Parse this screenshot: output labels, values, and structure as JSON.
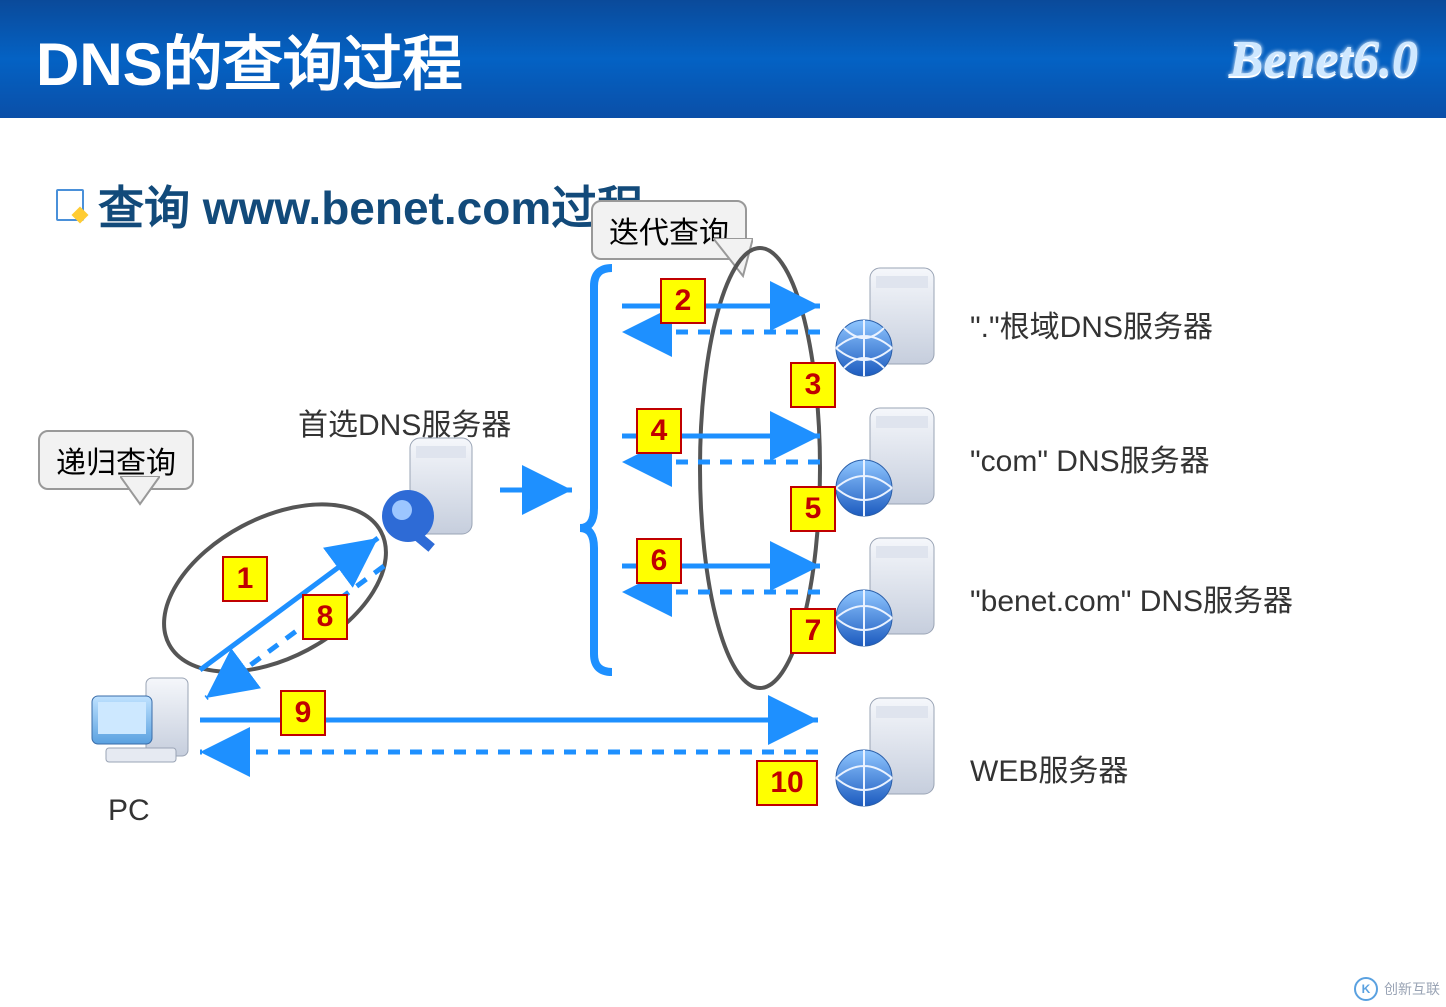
{
  "header": {
    "title": "DNS的查询过程",
    "brand": "Benet6.0"
  },
  "subtitle": "查询 www.benet.com过程",
  "callouts": {
    "recursive": "递归查询",
    "iterative": "迭代查询"
  },
  "nodes": {
    "pc": "PC",
    "local_dns": "首选DNS服务器",
    "root_dns": "\".\"根域DNS服务器",
    "com_dns": "\"com\" DNS服务器",
    "benet_dns": "\"benet.com\" DNS服务器",
    "web": "WEB服务器"
  },
  "steps": {
    "s1": "1",
    "s2": "2",
    "s3": "3",
    "s4": "4",
    "s5": "5",
    "s6": "6",
    "s7": "7",
    "s8": "8",
    "s9": "9",
    "s10": "10"
  },
  "watermark": "创新互联"
}
